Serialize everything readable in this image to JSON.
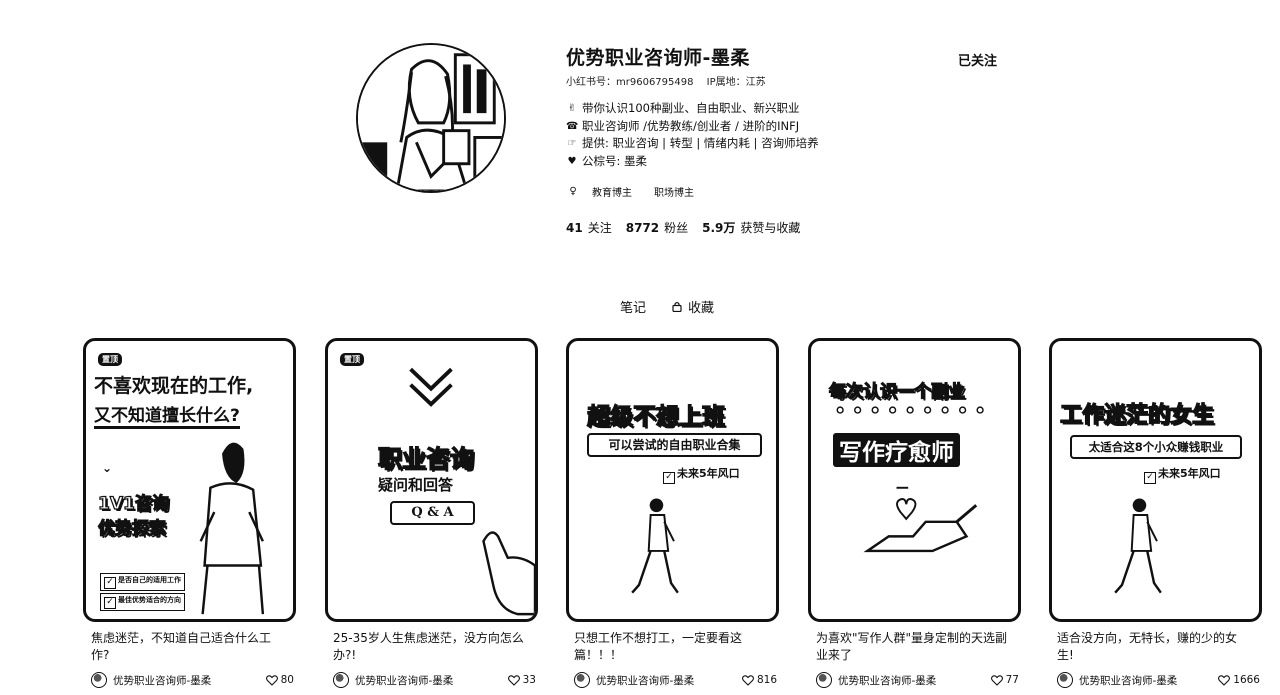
{
  "profile": {
    "name": "优势职业咨询师-墨柔",
    "id_label": "小红书号：mr9606795498",
    "ip_label": "IP属地：江苏",
    "follow_label": "已关注",
    "bio": [
      {
        "emoji": "✌",
        "text": "带你认识100种副业、自由职业、新兴职业"
      },
      {
        "emoji": "☎",
        "text": "职业咨询师 /优势教练/创业者 / 进阶的INFJ"
      },
      {
        "emoji": "☞",
        "text": "提供: 职业咨询 | 转型 | 情绪内耗 | 咨询师培养"
      },
      {
        "emoji": "♥",
        "text": "公棕号: 墨柔"
      }
    ],
    "tags": [
      "教育博主",
      "职场博主"
    ],
    "stats": [
      {
        "value": "41",
        "label": "关注"
      },
      {
        "value": "8772",
        "label": "粉丝"
      },
      {
        "value": "5.9万",
        "label": "获赞与收藏"
      }
    ]
  },
  "tabs": [
    {
      "label": "笔记"
    },
    {
      "label": "收藏"
    }
  ],
  "notes": [
    {
      "cover": {
        "badge": "置顶",
        "line1": "不喜欢现在的工作,",
        "line2": "又不知道擅长什么?",
        "line3": "1V1咨询",
        "line4": "优势探索",
        "item1": "是否自己的适用工作",
        "item2": "最佳优势适合的方向"
      },
      "title": "焦虑迷茫，不知道自己适合什么工作?",
      "author": "优势职业咨询师-墨柔",
      "likes": "80"
    },
    {
      "cover": {
        "badge": "置顶",
        "line1": "职业咨询",
        "line2": "疑问和回答",
        "line3": "Q & A"
      },
      "title": "25-35岁人生焦虑迷茫，没方向怎么办?!",
      "author": "优势职业咨询师-墨柔",
      "likes": "33"
    },
    {
      "cover": {
        "line1": "超级不想上班",
        "line2": "可以尝试的自由职业合集",
        "line3": "未来5年风口"
      },
      "title": "只想工作不想打工，一定要看这篇！！！",
      "author": "优势职业咨询师-墨柔",
      "likes": "816"
    },
    {
      "cover": {
        "line1": "每次认识一个副业",
        "line2": "写作疗愈师"
      },
      "title": "为喜欢\"写作人群\"量身定制的天选副业来了",
      "author": "优势职业咨询师-墨柔",
      "likes": "77"
    },
    {
      "cover": {
        "line1": "工作迷茫的女生",
        "line2": "太适合这8个小众赚钱职业",
        "line3": "未来5年风口"
      },
      "title": "适合没方向，无特长，赚的少的女生!",
      "author": "优势职业咨询师-墨柔",
      "likes": "1666"
    }
  ]
}
